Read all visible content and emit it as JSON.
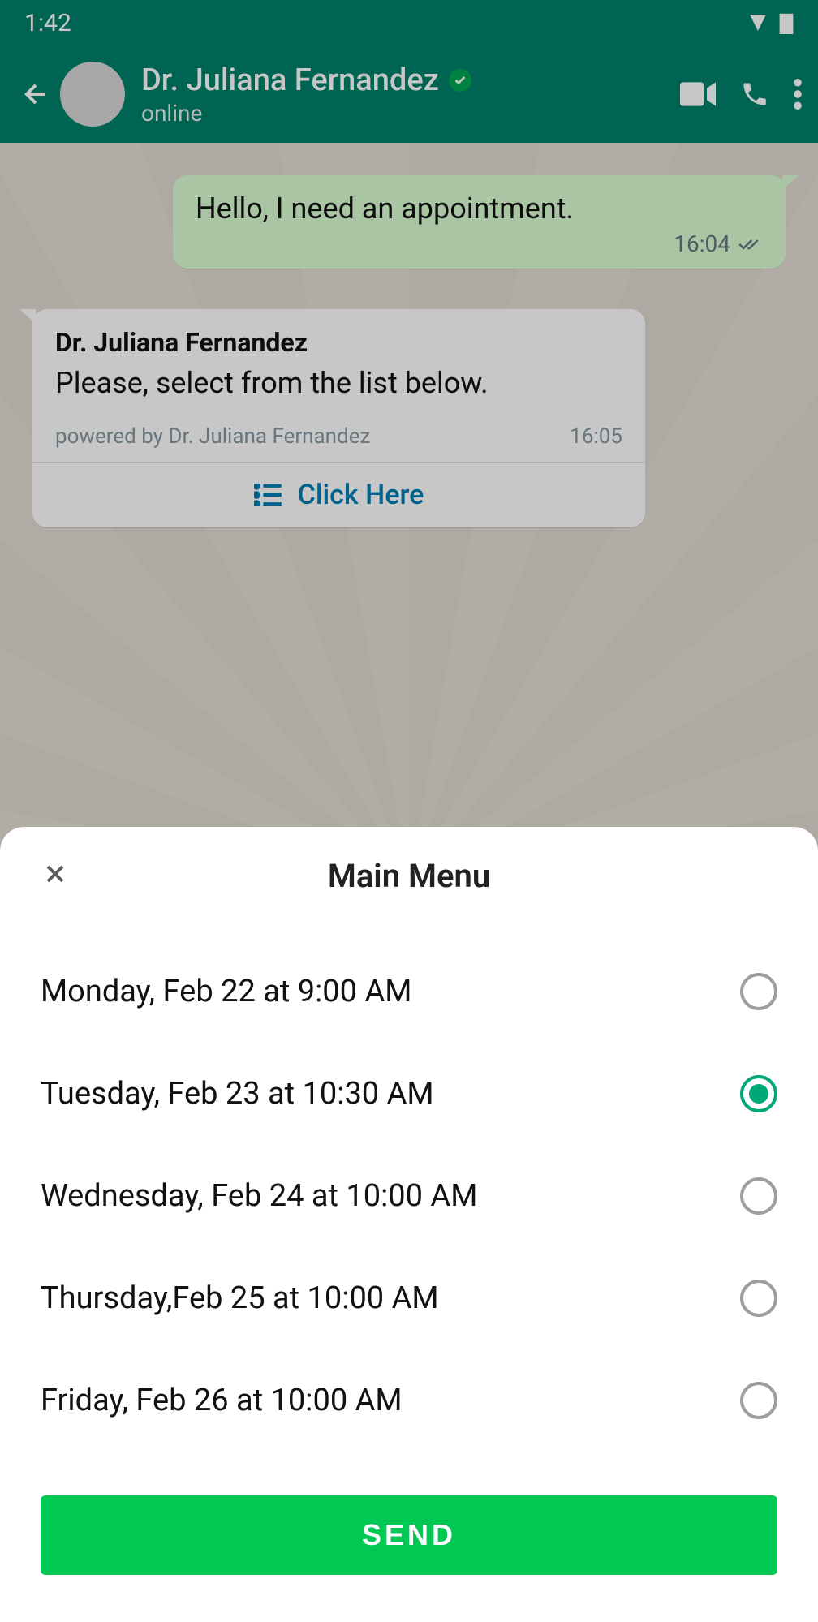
{
  "status": {
    "time": "1:42"
  },
  "header": {
    "contact_name": "Dr. Juliana Fernandez",
    "status": "online"
  },
  "messages": {
    "outgoing": {
      "text": "Hello, I need an appointment.",
      "time": "16:04"
    },
    "incoming": {
      "sender": "Dr. Juliana Fernandez",
      "text": "Please, select from the list below.",
      "powered_by": "powered by Dr. Juliana Fernandez",
      "time": "16:05",
      "button": "Click Here"
    }
  },
  "sheet": {
    "title": "Main Menu",
    "options": [
      {
        "label": "Monday, Feb 22 at 9:00 AM",
        "selected": false
      },
      {
        "label": "Tuesday, Feb 23 at 10:30 AM",
        "selected": true
      },
      {
        "label": "Wednesday, Feb 24 at 10:00 AM",
        "selected": false
      },
      {
        "label": "Thursday,Feb 25 at 10:00 AM",
        "selected": false
      },
      {
        "label": "Friday, Feb 26 at 10:00 AM",
        "selected": false
      }
    ],
    "send_label": "SEND"
  }
}
